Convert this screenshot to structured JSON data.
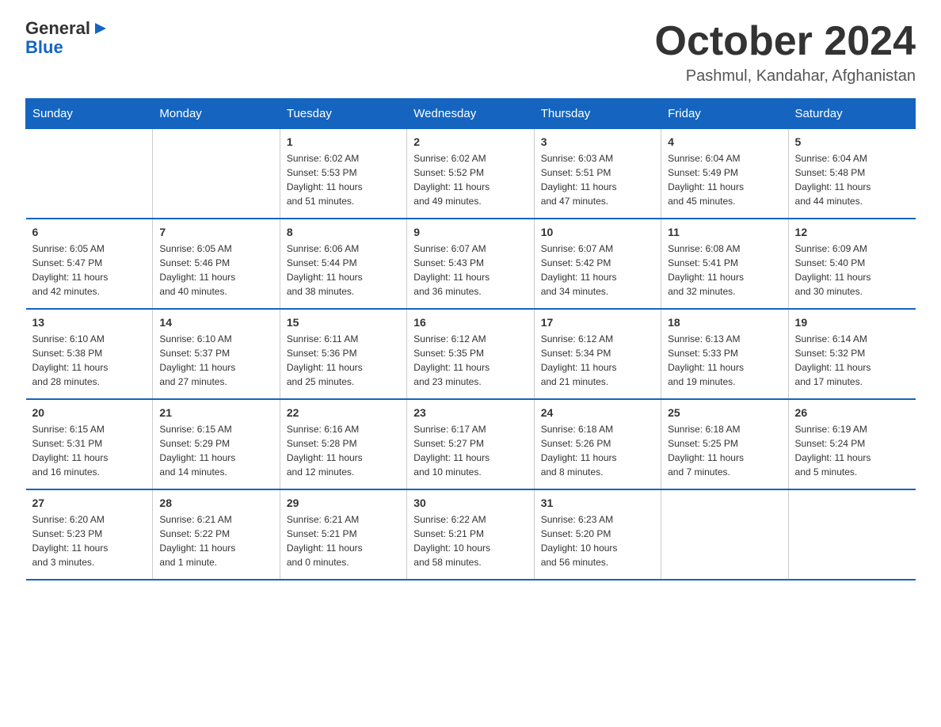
{
  "header": {
    "logo_line1": "General",
    "logo_line2": "Blue",
    "month_title": "October 2024",
    "location": "Pashmul, Kandahar, Afghanistan"
  },
  "days_of_week": [
    "Sunday",
    "Monday",
    "Tuesday",
    "Wednesday",
    "Thursday",
    "Friday",
    "Saturday"
  ],
  "weeks": [
    [
      {
        "day": "",
        "info": ""
      },
      {
        "day": "",
        "info": ""
      },
      {
        "day": "1",
        "info": "Sunrise: 6:02 AM\nSunset: 5:53 PM\nDaylight: 11 hours\nand 51 minutes."
      },
      {
        "day": "2",
        "info": "Sunrise: 6:02 AM\nSunset: 5:52 PM\nDaylight: 11 hours\nand 49 minutes."
      },
      {
        "day": "3",
        "info": "Sunrise: 6:03 AM\nSunset: 5:51 PM\nDaylight: 11 hours\nand 47 minutes."
      },
      {
        "day": "4",
        "info": "Sunrise: 6:04 AM\nSunset: 5:49 PM\nDaylight: 11 hours\nand 45 minutes."
      },
      {
        "day": "5",
        "info": "Sunrise: 6:04 AM\nSunset: 5:48 PM\nDaylight: 11 hours\nand 44 minutes."
      }
    ],
    [
      {
        "day": "6",
        "info": "Sunrise: 6:05 AM\nSunset: 5:47 PM\nDaylight: 11 hours\nand 42 minutes."
      },
      {
        "day": "7",
        "info": "Sunrise: 6:05 AM\nSunset: 5:46 PM\nDaylight: 11 hours\nand 40 minutes."
      },
      {
        "day": "8",
        "info": "Sunrise: 6:06 AM\nSunset: 5:44 PM\nDaylight: 11 hours\nand 38 minutes."
      },
      {
        "day": "9",
        "info": "Sunrise: 6:07 AM\nSunset: 5:43 PM\nDaylight: 11 hours\nand 36 minutes."
      },
      {
        "day": "10",
        "info": "Sunrise: 6:07 AM\nSunset: 5:42 PM\nDaylight: 11 hours\nand 34 minutes."
      },
      {
        "day": "11",
        "info": "Sunrise: 6:08 AM\nSunset: 5:41 PM\nDaylight: 11 hours\nand 32 minutes."
      },
      {
        "day": "12",
        "info": "Sunrise: 6:09 AM\nSunset: 5:40 PM\nDaylight: 11 hours\nand 30 minutes."
      }
    ],
    [
      {
        "day": "13",
        "info": "Sunrise: 6:10 AM\nSunset: 5:38 PM\nDaylight: 11 hours\nand 28 minutes."
      },
      {
        "day": "14",
        "info": "Sunrise: 6:10 AM\nSunset: 5:37 PM\nDaylight: 11 hours\nand 27 minutes."
      },
      {
        "day": "15",
        "info": "Sunrise: 6:11 AM\nSunset: 5:36 PM\nDaylight: 11 hours\nand 25 minutes."
      },
      {
        "day": "16",
        "info": "Sunrise: 6:12 AM\nSunset: 5:35 PM\nDaylight: 11 hours\nand 23 minutes."
      },
      {
        "day": "17",
        "info": "Sunrise: 6:12 AM\nSunset: 5:34 PM\nDaylight: 11 hours\nand 21 minutes."
      },
      {
        "day": "18",
        "info": "Sunrise: 6:13 AM\nSunset: 5:33 PM\nDaylight: 11 hours\nand 19 minutes."
      },
      {
        "day": "19",
        "info": "Sunrise: 6:14 AM\nSunset: 5:32 PM\nDaylight: 11 hours\nand 17 minutes."
      }
    ],
    [
      {
        "day": "20",
        "info": "Sunrise: 6:15 AM\nSunset: 5:31 PM\nDaylight: 11 hours\nand 16 minutes."
      },
      {
        "day": "21",
        "info": "Sunrise: 6:15 AM\nSunset: 5:29 PM\nDaylight: 11 hours\nand 14 minutes."
      },
      {
        "day": "22",
        "info": "Sunrise: 6:16 AM\nSunset: 5:28 PM\nDaylight: 11 hours\nand 12 minutes."
      },
      {
        "day": "23",
        "info": "Sunrise: 6:17 AM\nSunset: 5:27 PM\nDaylight: 11 hours\nand 10 minutes."
      },
      {
        "day": "24",
        "info": "Sunrise: 6:18 AM\nSunset: 5:26 PM\nDaylight: 11 hours\nand 8 minutes."
      },
      {
        "day": "25",
        "info": "Sunrise: 6:18 AM\nSunset: 5:25 PM\nDaylight: 11 hours\nand 7 minutes."
      },
      {
        "day": "26",
        "info": "Sunrise: 6:19 AM\nSunset: 5:24 PM\nDaylight: 11 hours\nand 5 minutes."
      }
    ],
    [
      {
        "day": "27",
        "info": "Sunrise: 6:20 AM\nSunset: 5:23 PM\nDaylight: 11 hours\nand 3 minutes."
      },
      {
        "day": "28",
        "info": "Sunrise: 6:21 AM\nSunset: 5:22 PM\nDaylight: 11 hours\nand 1 minute."
      },
      {
        "day": "29",
        "info": "Sunrise: 6:21 AM\nSunset: 5:21 PM\nDaylight: 11 hours\nand 0 minutes."
      },
      {
        "day": "30",
        "info": "Sunrise: 6:22 AM\nSunset: 5:21 PM\nDaylight: 10 hours\nand 58 minutes."
      },
      {
        "day": "31",
        "info": "Sunrise: 6:23 AM\nSunset: 5:20 PM\nDaylight: 10 hours\nand 56 minutes."
      },
      {
        "day": "",
        "info": ""
      },
      {
        "day": "",
        "info": ""
      }
    ]
  ]
}
